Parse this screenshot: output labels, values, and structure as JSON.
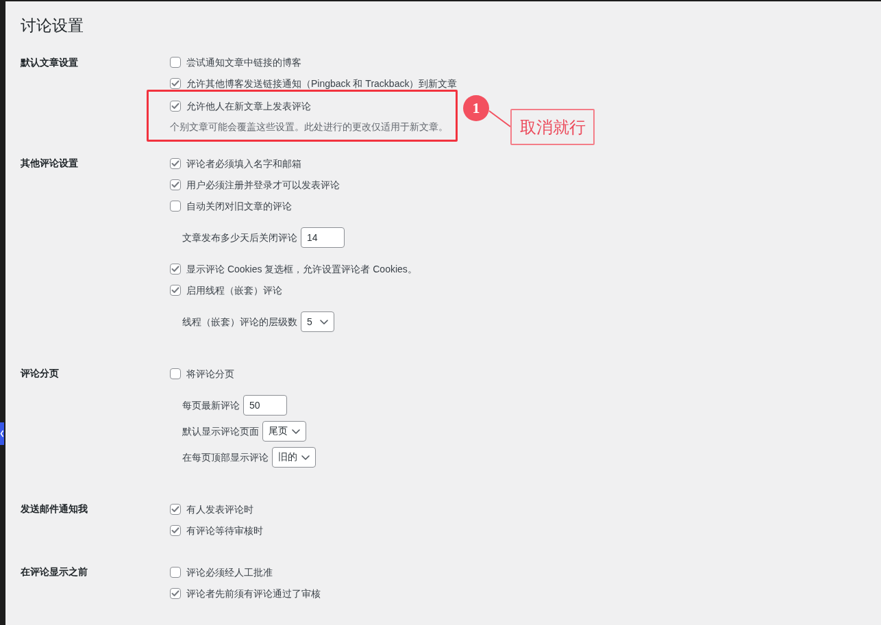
{
  "page_title": "讨论设置",
  "sections": [
    {
      "label": "默认文章设置",
      "items": [
        {
          "kind": "checkbox",
          "label": "尝试通知文章中链接的博客",
          "checked": false
        },
        {
          "kind": "checkbox",
          "label": "允许其他博客发送链接通知（Pingback 和 Trackback）到新文章",
          "checked": true
        },
        {
          "kind": "callout",
          "marker": "1",
          "note": "取消就行",
          "items": [
            {
              "kind": "checkbox",
              "label": "允许他人在新文章上发表评论",
              "checked": true
            },
            {
              "kind": "description",
              "text": "个别文章可能会覆盖这些设置。此处进行的更改仅适用于新文章。"
            }
          ]
        }
      ]
    },
    {
      "label": "其他评论设置",
      "items": [
        {
          "kind": "checkbox",
          "label": "评论者必须填入名字和邮箱",
          "checked": true
        },
        {
          "kind": "checkbox",
          "label": "用户必须注册并登录才可以发表评论",
          "checked": true
        },
        {
          "kind": "checkbox",
          "label": "自动关闭对旧文章的评论",
          "checked": false
        },
        {
          "kind": "number",
          "label": "文章发布多少天后关闭评论",
          "value": "14"
        },
        {
          "kind": "checkbox",
          "label": "显示评论 Cookies 复选框，允许设置评论者 Cookies。",
          "checked": true
        },
        {
          "kind": "checkbox",
          "label": "启用线程（嵌套）评论",
          "checked": true
        },
        {
          "kind": "select",
          "label": "线程（嵌套）评论的层级数",
          "value": "5"
        }
      ]
    },
    {
      "label": "评论分页",
      "items": [
        {
          "kind": "checkbox",
          "label": "将评论分页",
          "checked": false
        },
        {
          "kind": "number",
          "label": "每页最新评论",
          "value": "50"
        },
        {
          "kind": "select",
          "label": "默认显示评论页面",
          "value": "尾页"
        },
        {
          "kind": "select",
          "label": "在每页顶部显示评论",
          "value": "旧的"
        }
      ]
    },
    {
      "label": "发送邮件通知我",
      "items": [
        {
          "kind": "checkbox",
          "label": "有人发表评论时",
          "checked": true
        },
        {
          "kind": "checkbox",
          "label": "有评论等待审核时",
          "checked": true
        }
      ]
    },
    {
      "label": "在评论显示之前",
      "items": [
        {
          "kind": "checkbox",
          "label": "评论必须经人工批准",
          "checked": false
        },
        {
          "kind": "checkbox",
          "label": "评论者先前须有评论通过了审核",
          "checked": true
        }
      ]
    }
  ]
}
